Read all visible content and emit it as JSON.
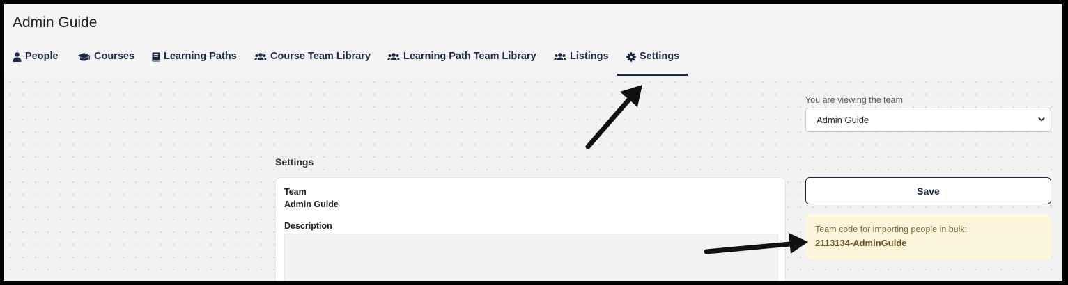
{
  "header": {
    "title": "Admin Guide"
  },
  "nav": {
    "tabs": [
      {
        "label": "People",
        "icon": "user-icon"
      },
      {
        "label": "Courses",
        "icon": "graduation-cap-icon"
      },
      {
        "label": "Learning Paths",
        "icon": "book-icon"
      },
      {
        "label": "Course Team Library",
        "icon": "users-icon"
      },
      {
        "label": "Learning Path Team Library",
        "icon": "users-icon"
      },
      {
        "label": "Listings",
        "icon": "users-icon"
      },
      {
        "label": "Settings",
        "icon": "gear-icon",
        "active": true
      }
    ]
  },
  "sidebar": {
    "viewing_label": "You are viewing the team",
    "team_select_value": "Admin Guide",
    "save_label": "Save",
    "team_code_label": "Team code for importing people in bulk:",
    "team_code_value": "2113134-AdminGuide"
  },
  "main": {
    "heading": "Settings",
    "team_label": "Team",
    "team_value": "Admin Guide",
    "description_label": "Description",
    "description_value": ""
  },
  "colors": {
    "accent": "#1b2a47",
    "background": "#f4f4f4",
    "code_box_bg": "#fdf6dc",
    "code_text": "#6b5320"
  }
}
